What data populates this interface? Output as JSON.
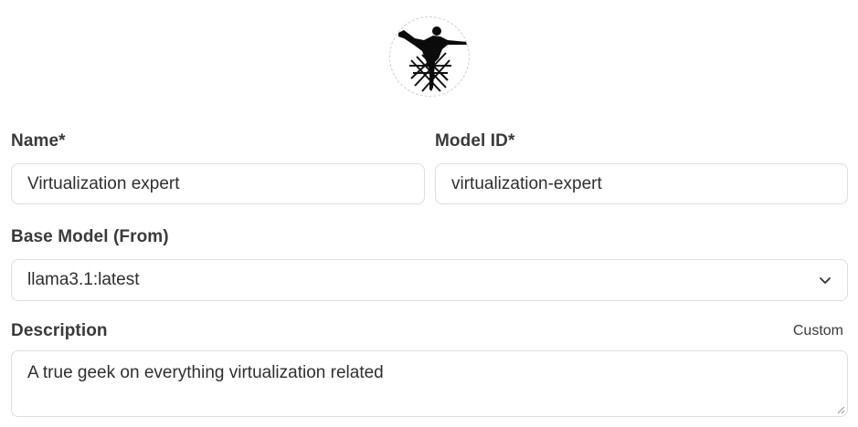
{
  "form": {
    "name_label": "Name*",
    "name_value": "Virtualization expert",
    "model_id_label": "Model ID*",
    "model_id_value": "virtualization-expert",
    "base_model_label": "Base Model (From)",
    "base_model_value": "llama3.1:latest",
    "description_label": "Description",
    "description_mode": "Custom",
    "description_value": "A true geek on everything virtualization related"
  },
  "icons": {
    "avatar": "martial-artist-silhouette-icon",
    "select": "chevron-down-icon",
    "resize": "resize-grip-icon"
  }
}
